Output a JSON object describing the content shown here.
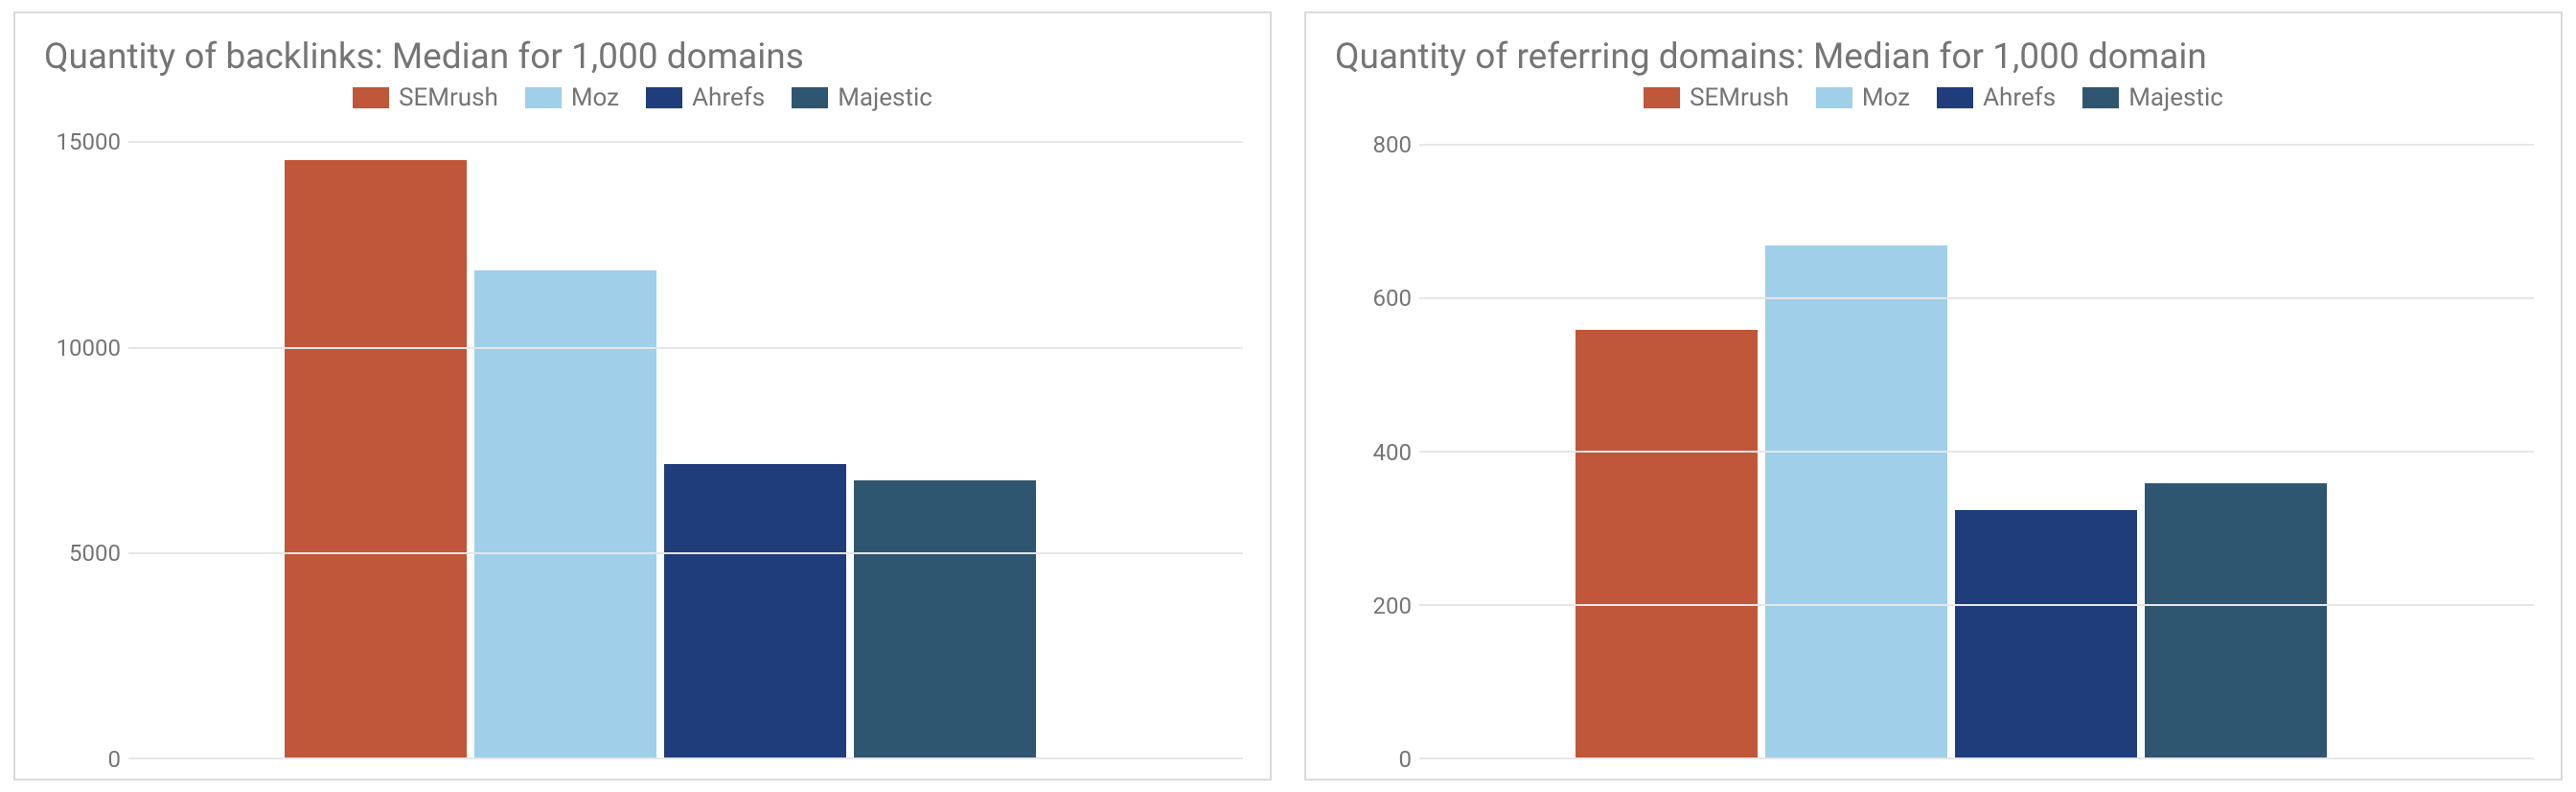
{
  "chart_data": [
    {
      "type": "bar",
      "title": "Quantity of backlinks: Median for 1,000 domains",
      "categories": [
        ""
      ],
      "series": [
        {
          "name": "SEMrush",
          "color": "#c0563a",
          "values": [
            14600
          ]
        },
        {
          "name": "Moz",
          "color": "#a0cfea",
          "values": [
            11900
          ]
        },
        {
          "name": "Ahrefs",
          "color": "#1f3d7a",
          "values": [
            7200
          ]
        },
        {
          "name": "Majestic",
          "color": "#2f5670",
          "values": [
            6800
          ]
        }
      ],
      "y_ticks": [
        0,
        5000,
        10000,
        15000
      ],
      "ylim": [
        0,
        15500
      ],
      "xlabel": "",
      "ylabel": ""
    },
    {
      "type": "bar",
      "title": "Quantity of referring domains: Median for 1,000 domain",
      "categories": [
        ""
      ],
      "series": [
        {
          "name": "SEMrush",
          "color": "#c0563a",
          "values": [
            560
          ]
        },
        {
          "name": "Moz",
          "color": "#a0cfea",
          "values": [
            670
          ]
        },
        {
          "name": "Ahrefs",
          "color": "#1f3d7a",
          "values": [
            325
          ]
        },
        {
          "name": "Majestic",
          "color": "#2f5670",
          "values": [
            360
          ]
        }
      ],
      "y_ticks": [
        0,
        200,
        400,
        600,
        800
      ],
      "ylim": [
        0,
        830
      ],
      "xlabel": "",
      "ylabel": ""
    }
  ]
}
